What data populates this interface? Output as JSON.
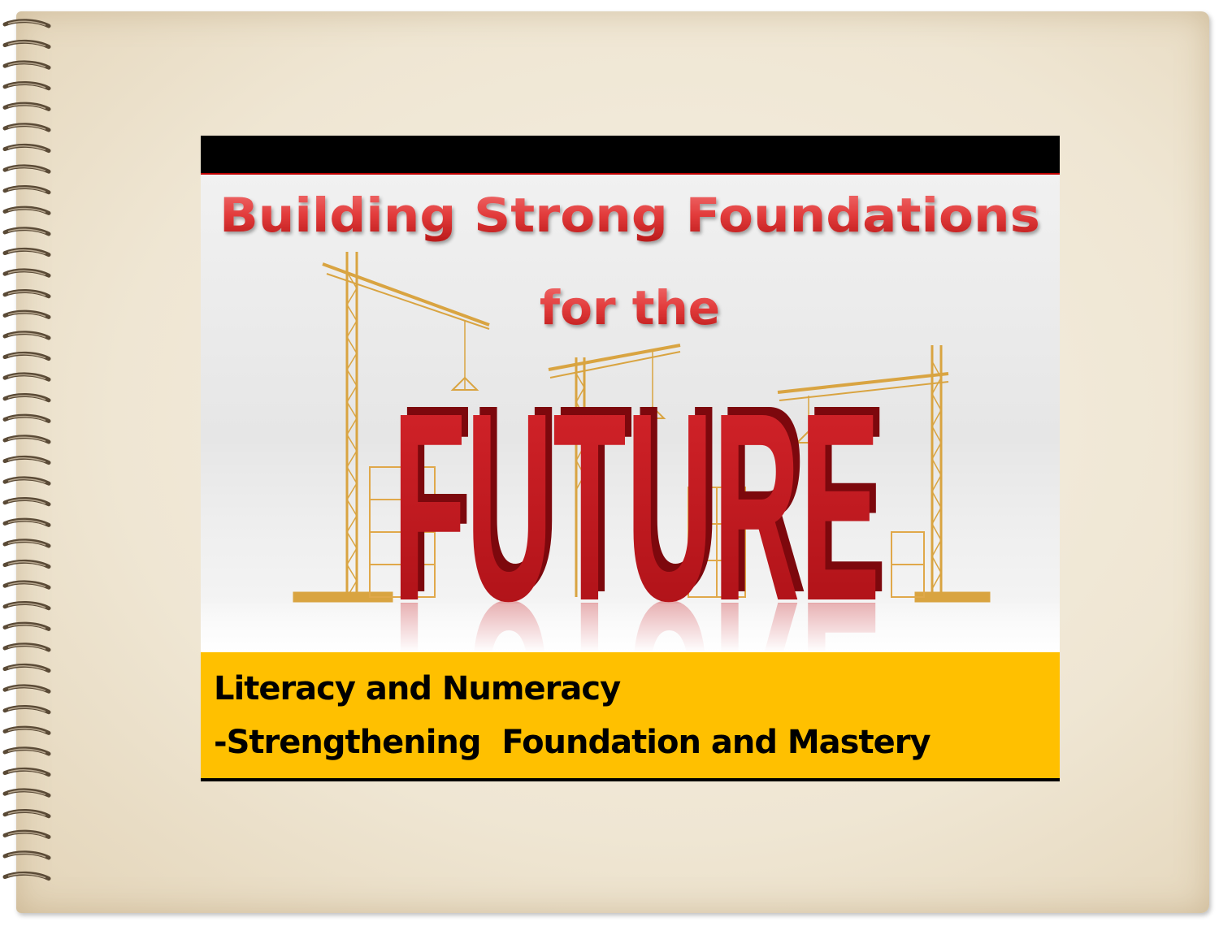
{
  "slide": {
    "title_line1": "Building Strong Foundations",
    "title_line2": "for the",
    "big_word": "FUTURE",
    "caption_line1": "Literacy and Numeracy",
    "caption_line2": "-Strengthening  Foundation and Mastery"
  },
  "colors": {
    "title_red": "#e23b3b",
    "letters_red": "#c8141b",
    "caption_bg": "#ffc000",
    "crane_gold": "#d9a441",
    "top_bar": "#000000"
  },
  "icons": {
    "spiral": "spiral-binding-icon",
    "crane": "crane-icon",
    "scaffold": "scaffold-icon"
  }
}
